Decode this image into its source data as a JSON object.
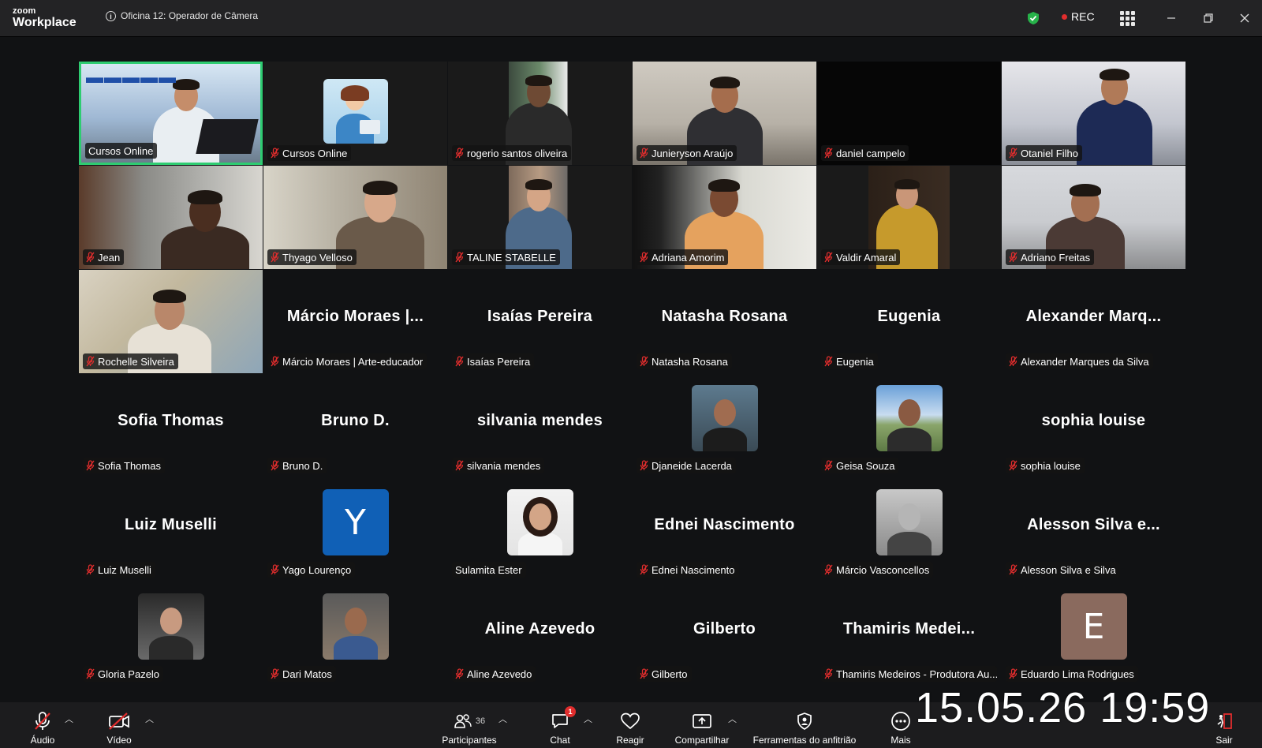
{
  "app": {
    "logo_top": "zoom",
    "logo_bottom": "Workplace"
  },
  "meeting": {
    "title": "Oficina 12: Operador de Câmera",
    "rec_label": "REC"
  },
  "colors": {
    "active_speaker": "#2ecc71",
    "muted_mic": "#e02d2d",
    "background": "#111214"
  },
  "tiles": [
    {
      "name": "Cursos Online",
      "display": "",
      "kind": "video"
    },
    {
      "name": "Cursos Online",
      "display": "",
      "kind": "video"
    },
    {
      "name": "rogerio santos oliveira",
      "display": "",
      "kind": "video"
    },
    {
      "name": "Junieryson Araújo",
      "display": "",
      "kind": "video"
    },
    {
      "name": "daniel campelo",
      "display": "",
      "kind": "video"
    },
    {
      "name": "Otaniel Filho",
      "display": "",
      "kind": "video"
    },
    {
      "name": "Jean",
      "display": "",
      "kind": "video"
    },
    {
      "name": "Thyago Velloso",
      "display": "",
      "kind": "video"
    },
    {
      "name": "TALINE STABELLE",
      "display": "",
      "kind": "video"
    },
    {
      "name": "Adriana Amorim",
      "display": "",
      "kind": "video"
    },
    {
      "name": "Valdir Amaral",
      "display": "",
      "kind": "video"
    },
    {
      "name": "Adriano Freitas",
      "display": "",
      "kind": "video"
    },
    {
      "name": "Rochelle Silveira",
      "display": "",
      "kind": "video"
    },
    {
      "name": "Márcio Moraes | Arte-educador",
      "display": "Márcio  Moraes  |...",
      "kind": "name"
    },
    {
      "name": "Isaías Pereira",
      "display": "Isaías Pereira",
      "kind": "name"
    },
    {
      "name": "Natasha Rosana",
      "display": "Natasha Rosana",
      "kind": "name"
    },
    {
      "name": "Eugenia",
      "display": "Eugenia",
      "kind": "name"
    },
    {
      "name": "Alexander Marques da Silva",
      "display": "Alexander  Marq...",
      "kind": "name"
    },
    {
      "name": "Sofia Thomas",
      "display": "Sofia Thomas",
      "kind": "name"
    },
    {
      "name": "Bruno D.",
      "display": "Bruno D.",
      "kind": "name"
    },
    {
      "name": "silvania mendes",
      "display": "silvania mendes",
      "kind": "name"
    },
    {
      "name": "Djaneide Lacerda",
      "display": "",
      "kind": "photo"
    },
    {
      "name": "Geisa Souza",
      "display": "",
      "kind": "photo"
    },
    {
      "name": "sophia louise",
      "display": "sophia louise",
      "kind": "name"
    },
    {
      "name": "Luiz Muselli",
      "display": "Luiz Muselli",
      "kind": "name"
    },
    {
      "name": "Yago Lourenço",
      "display": "Y",
      "kind": "letter"
    },
    {
      "name": "Sulamita Ester",
      "display": "",
      "kind": "photo"
    },
    {
      "name": "Ednei Nascimento",
      "display": "Ednei Nascimento",
      "kind": "name"
    },
    {
      "name": "Márcio Vasconcellos",
      "display": "",
      "kind": "photo"
    },
    {
      "name": "Alesson Silva e Silva",
      "display": "Alesson  Silva  e...",
      "kind": "name"
    },
    {
      "name": "Gloria Pazelo",
      "display": "",
      "kind": "photo"
    },
    {
      "name": "Dari Matos",
      "display": "",
      "kind": "photo"
    },
    {
      "name": "Aline Azevedo",
      "display": "Aline Azevedo",
      "kind": "name"
    },
    {
      "name": "Gilberto",
      "display": "Gilberto",
      "kind": "name"
    },
    {
      "name": "Thamiris Medeiros - Produtora Au...",
      "display": "Thamiris  Medei...",
      "kind": "name"
    },
    {
      "name": "Eduardo Lima Rodrigues",
      "display": "E",
      "kind": "letter"
    }
  ],
  "toolbar": {
    "audio": "Áudio",
    "video": "Vídeo",
    "participants": "Participantes",
    "participants_count": "36",
    "chat": "Chat",
    "chat_badge": "1",
    "react": "Reagir",
    "share": "Compartilhar",
    "host_tools": "Ferramentas do anfitrião",
    "more": "Mais",
    "leave": "Sair"
  },
  "overlay": {
    "timestamp": "15.05.26 19:59"
  }
}
